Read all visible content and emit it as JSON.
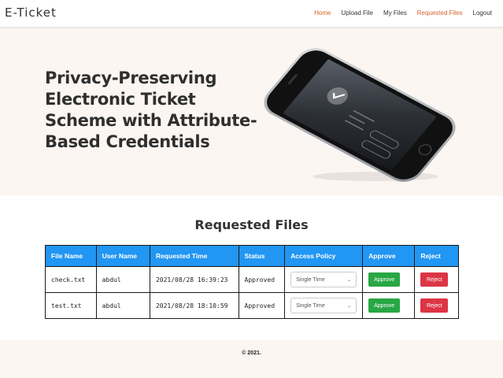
{
  "brand": "E-Ticket",
  "nav": {
    "items": [
      {
        "label": "Home",
        "active": true
      },
      {
        "label": "Upload File",
        "active": false
      },
      {
        "label": "My Files",
        "active": false
      },
      {
        "label": "Requested Files",
        "active": true
      },
      {
        "label": "Logout",
        "active": false
      }
    ]
  },
  "hero": {
    "title": "Privacy-Preserving Electronic Ticket Scheme with Attribute-Based Credentials"
  },
  "requested": {
    "title": "Requested Files",
    "columns": [
      "File Name",
      "User Name",
      "Requested Time",
      "Status",
      "Access Policy",
      "Approve",
      "Reject"
    ],
    "rows": [
      {
        "file": "check.txt",
        "user": "abdul",
        "time": "2021/08/28 16:39:23",
        "status": "Approved",
        "policy": "Single Time",
        "approve": "Approve",
        "reject": "Reject"
      },
      {
        "file": "test.txt",
        "user": "abdul",
        "time": "2021/08/28 18:10:59",
        "status": "Approved",
        "policy": "Single Time",
        "approve": "Approve",
        "reject": "Reject"
      }
    ]
  },
  "footer": {
    "text": "© 2021."
  },
  "colors": {
    "accent": "#d9622b",
    "table_header": "#2196f3",
    "approve": "#28a745",
    "reject": "#dc3545",
    "hero_bg": "#fbf6f2"
  }
}
